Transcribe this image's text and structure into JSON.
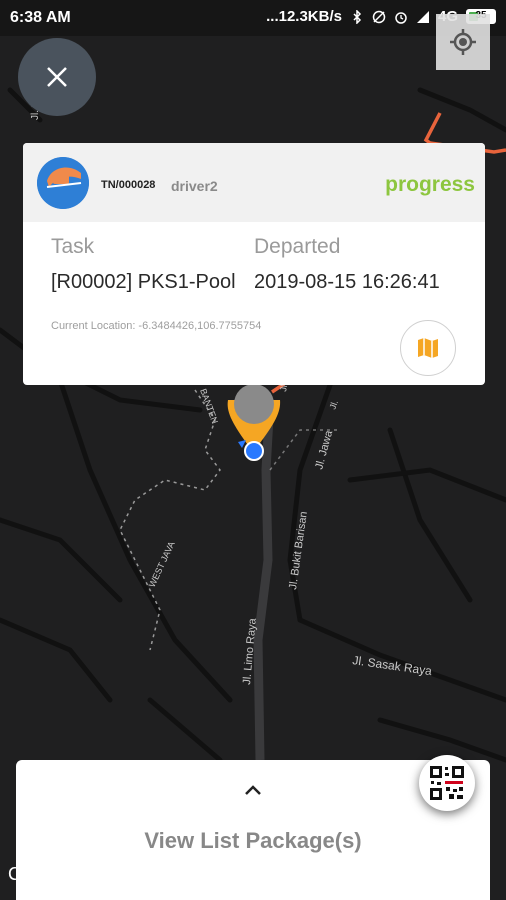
{
  "status_bar": {
    "time": "6:38 AM",
    "network_speed": "...12.3KB/s",
    "network_type": "4G",
    "battery_level": "35"
  },
  "card": {
    "tn_number": "TN/000028",
    "driver": "driver2",
    "status": "progress",
    "task_label": "Task",
    "task_value": "[R00002] PKS1-Pool",
    "departed_label": "Departed",
    "departed_value": "2019-08-15 16:26:41",
    "current_location": "Current Location: -6.3484426,106.7755754"
  },
  "map_labels": {
    "banten": "BANTEN",
    "jawa": "Jl. Jawa",
    "bukit_barisan": "Jl. Bukit Barisan",
    "west_jawa": "WEST JAVA",
    "limo_raya": "Jl. Limo Raya",
    "sasak_raya": "Jl. Sasak Raya",
    "jl_pd": "Jl. Pd",
    "jl_small": "Jl.",
    "jl_g": "Jl. G"
  },
  "bottom_sheet": {
    "view_list_label": "View List Package(s)"
  },
  "edge_glyph": "C",
  "colors": {
    "status_green": "#8dc63f",
    "marker_orange": "#f5a623",
    "route_orange": "#e8643c",
    "location_blue": "#2979ff"
  }
}
